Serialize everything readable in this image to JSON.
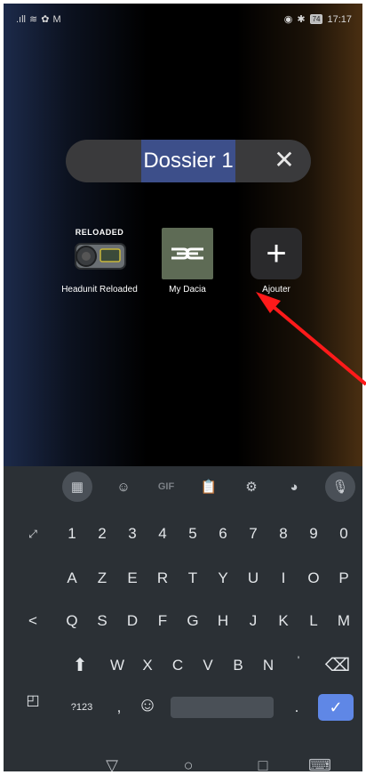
{
  "status_bar": {
    "time": "17:17",
    "battery": "74",
    "icons": [
      "signal-icon",
      "wifi-icon",
      "nfc-icon",
      "gmail-icon",
      "eye-icon",
      "bluetooth-icon",
      "battery-icon"
    ]
  },
  "folder": {
    "name": "Dossier 1",
    "close_icon": "close-icon"
  },
  "apps": [
    {
      "label": "Headunit Reloaded",
      "badge_text": "RELOADED"
    },
    {
      "label": "My Dacia"
    },
    {
      "label": "Ajouter",
      "glyph": "+"
    }
  ],
  "keyboard": {
    "toolbar": [
      "grid-icon",
      "sticker-icon",
      "GIF",
      "clipboard-icon",
      "gear-icon",
      "palette-icon",
      "mic-icon"
    ],
    "gif_label": "GIF",
    "row_numbers": [
      "1",
      "2",
      "3",
      "4",
      "5",
      "6",
      "7",
      "8",
      "9",
      "0"
    ],
    "row1": [
      "A",
      "Z",
      "E",
      "R",
      "T",
      "Y",
      "U",
      "I",
      "O",
      "P"
    ],
    "row2": [
      "Q",
      "S",
      "D",
      "F",
      "G",
      "H",
      "J",
      "K",
      "L",
      "M"
    ],
    "row3": [
      "W",
      "X",
      "C",
      "V",
      "B",
      "N",
      "'"
    ],
    "sym_label": "?123",
    "comma": ",",
    "period": ".",
    "enter_glyph": "✓",
    "resize_glyph": "⤢",
    "back_glyph": "<",
    "shift_glyph": "⬆",
    "backspace_glyph": "⌫",
    "emoji_glyph": "☺"
  },
  "navbar": {
    "back": "▽",
    "home": "○",
    "recents": "□",
    "keyboard": "⌨"
  },
  "colors": {
    "accent_enter": "#5f87e6",
    "selection": "#3d4f8a",
    "arrow": "#ff1a1a"
  }
}
